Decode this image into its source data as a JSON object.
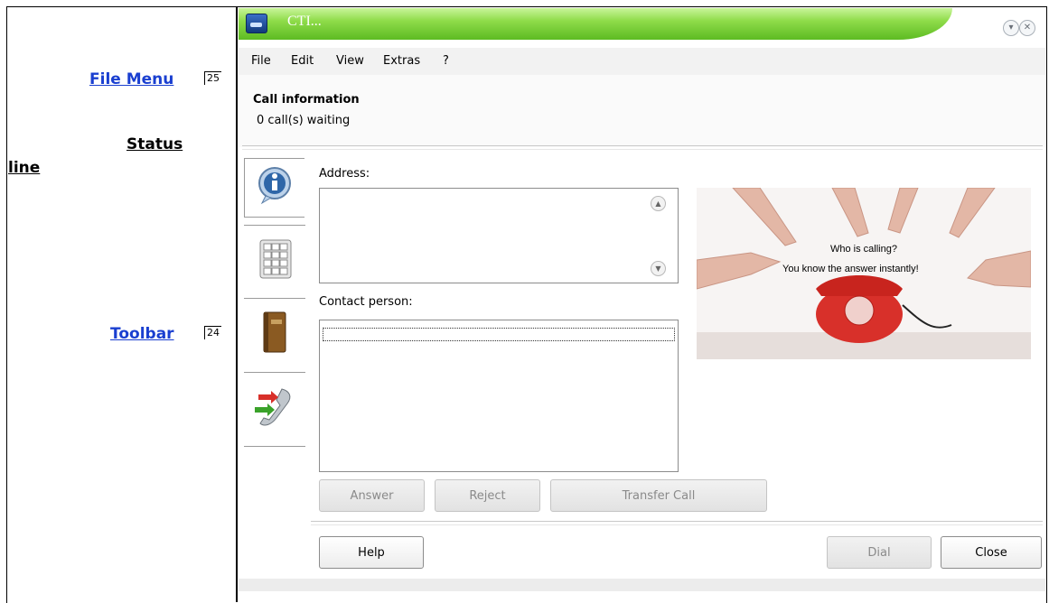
{
  "annotations": {
    "file_menu": {
      "label": "File Menu",
      "ref": "25"
    },
    "status_line": {
      "line1": "Status",
      "line2": "line"
    },
    "toolbar": {
      "label": "Toolbar",
      "ref": "24"
    }
  },
  "window": {
    "title": "CTI...",
    "controls": {
      "minimize": "▾",
      "close": "✕"
    },
    "menu": [
      "File",
      "Edit",
      "View",
      "Extras",
      "?"
    ],
    "call_info": {
      "title": "Call information",
      "status": "0 call(s) waiting"
    },
    "sidebar": [
      {
        "icon": "info-icon"
      },
      {
        "icon": "keypad-icon"
      },
      {
        "icon": "address-book-icon"
      },
      {
        "icon": "call-transfer-icon"
      }
    ],
    "address": {
      "label": "Address:",
      "value": ""
    },
    "contact": {
      "label": "Contact person:",
      "value": ""
    },
    "photo": {
      "line1": "Who is calling?",
      "line2": "You know the answer instantly!"
    },
    "actions": {
      "answer": "Answer",
      "reject": "Reject",
      "transfer": "Transfer Call"
    },
    "footer": {
      "help": "Help",
      "dial": "Dial",
      "close": "Close"
    }
  },
  "colors": {
    "title_green": "#5dbb22",
    "link_blue": "#1a3fd0",
    "phone_red": "#d8302a"
  }
}
